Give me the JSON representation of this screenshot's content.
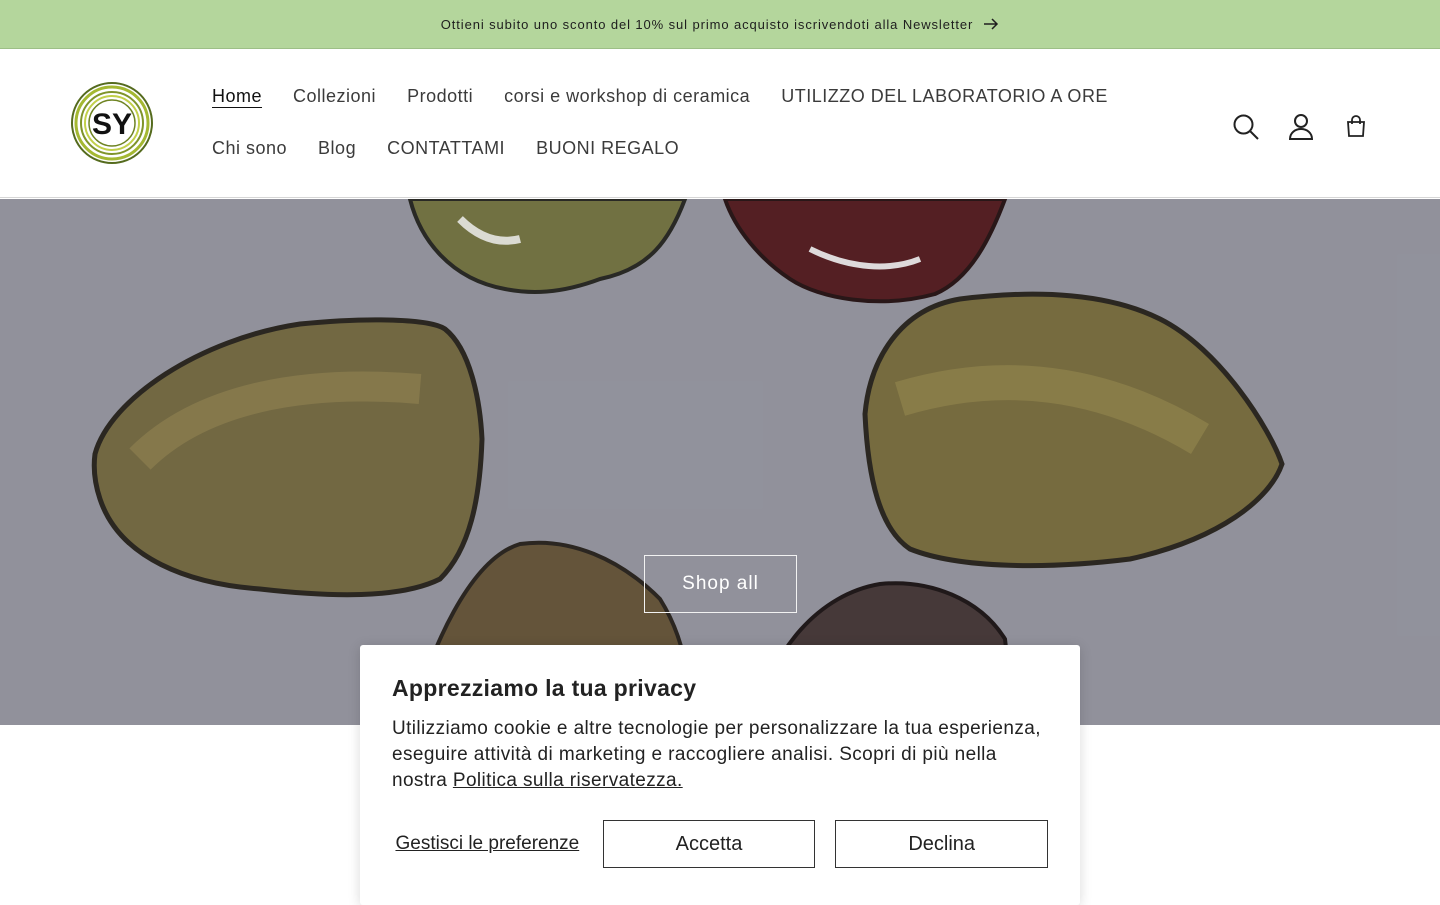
{
  "announcement": {
    "text": "Ottieni subito uno sconto del 10% sul primo acquisto iscrivendoti alla Newsletter",
    "arrow_icon": "arrow-right-icon"
  },
  "header": {
    "logo_text": "SY",
    "nav_row1": [
      "Home",
      "Collezioni",
      "Prodotti",
      "corsi e workshop di ceramica",
      "UTILIZZO DEL LABORATORIO A ORE"
    ],
    "nav_row2": [
      "Chi sono",
      "Blog",
      "CONTATTAMI",
      "BUONI REGALO"
    ],
    "active": "Home",
    "icons": [
      "search-icon",
      "account-icon",
      "cart-icon"
    ]
  },
  "hero": {
    "button_label": "Shop all"
  },
  "cookie": {
    "title": "Apprezziamo la tua privacy",
    "body": "Utilizziamo cookie e altre tecnologie per personalizzare la tua esperienza, eseguire attività di marketing e raccogliere analisi. Scopri di più nella nostra ",
    "link": "Politica sulla riservatezza.",
    "manage": "Gestisci le preferenze",
    "accept": "Accetta",
    "decline": "Declina"
  },
  "colors": {
    "announcement_bg": "#b4d69c",
    "logo_green": "#8aa22a"
  }
}
